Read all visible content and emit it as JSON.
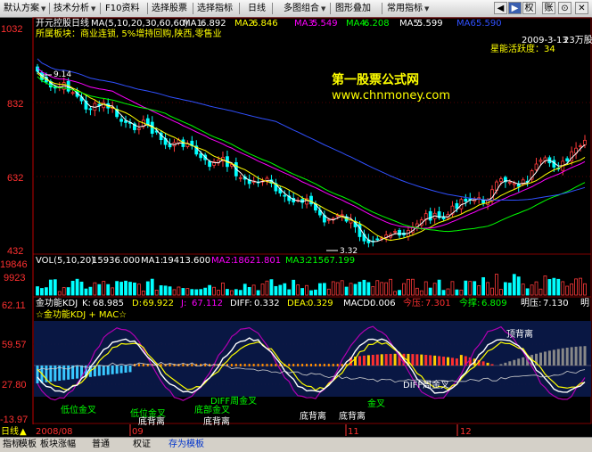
{
  "toolbar": {
    "items": [
      {
        "label": "默认方案",
        "dropdown": true
      },
      {
        "label": "技术分析",
        "dropdown": true
      },
      {
        "label": "F10资料",
        "dropdown": false
      },
      {
        "label": "选择股票",
        "dropdown": false
      },
      {
        "label": "选择指标",
        "dropdown": false
      },
      {
        "label": "日线",
        "dropdown": false
      },
      {
        "label": "多图组合",
        "dropdown": true
      },
      {
        "label": "图形叠加",
        "dropdown": false
      },
      {
        "label": "常用指标",
        "dropdown": true
      }
    ],
    "window_buttons": [
      "◀",
      "▶",
      "权",
      "账",
      "⊙",
      "✕"
    ]
  },
  "price_panel": {
    "name": "开元控股",
    "period": "日线",
    "ma_params": "MA(5,10,20,30,60,60)",
    "ma1_label": "MA1:",
    "ma1_value": "6.892",
    "ma2_label": "MA2:",
    "ma2_value": "6.846",
    "ma3_label": "MA3:",
    "ma3_value": "5.549",
    "ma4_label": "MA4:",
    "ma4_value": "6.208",
    "ma5_label": "MA5:",
    "ma5_value": "5.599",
    "ma6_label": "MA6:",
    "ma6_value": "5.590",
    "sector_line": "所属板块：商业连锁, 5%增持回购,陕西,零售业",
    "date_info": "2009-3-13",
    "share_info": "23万股",
    "star_info": "星能活跃度：34",
    "watermark_title": "第一股票公式网",
    "watermark_url": "www.chnmoney.com",
    "high_label": "9.14",
    "low_label": "3.32",
    "y_ticks": [
      "1032",
      "832",
      "632",
      "432"
    ]
  },
  "volume_panel": {
    "header_label": "VOL(5,10,20)",
    "vol_value": "15936.000",
    "ma1_label": "MA1:",
    "ma1_value": "19413.600",
    "ma2_label": "MA2:",
    "ma2_value": "18621.801",
    "ma3_label": "MA3:",
    "ma3_value": "21567.199",
    "y_ticks": [
      "19846",
      "9923"
    ]
  },
  "kdj_panel": {
    "title": "金功能KDJ",
    "k_label": "K:",
    "k_value": "68.985",
    "d_label": "D:",
    "d_value": "69.922",
    "j_label": "J:",
    "j_value": "67.112",
    "diff_label": "DIFF:",
    "diff_value": "0.332",
    "dea_label": "DEA:",
    "dea_value": "0.329",
    "macd_label": "MACD:",
    "macd_value": "0.006",
    "jinya_label": "今压:",
    "jinya_value": "7.301",
    "jinzhi_label": "今撑:",
    "jinzhi_value": "6.809",
    "mingya_label": "明压:",
    "mingya_value": "7.130",
    "ming_suffix": "明",
    "subtitle": "☆金功能KDJ + MAC☆",
    "y_ticks": [
      "62.11",
      "59.57",
      "27.80",
      "-13.97"
    ],
    "annotations": {
      "top_divergence": "顶背离",
      "diff_week_golden": "DIFF周金叉",
      "golden_cross_1": "低位金叉",
      "golden_cross_2": "低位金叉",
      "bottom_golden": "底部金叉",
      "bottom_div_1": "底背离",
      "bottom_div_2": "底背离",
      "bottom_div_3": "底背离",
      "bottom_div_4": "底背离",
      "week_golden": "DIFF周金叉",
      "cross_4": "金叉"
    }
  },
  "time_axis": {
    "period_label": "日线",
    "labels": [
      "2008/08",
      "09",
      "11",
      "12"
    ]
  },
  "bottom_tabs": [
    "指标",
    "模板",
    "板块涨幅",
    "普通",
    "权证",
    "存为模板"
  ],
  "colors": {
    "up": "#ff3a3a",
    "down": "#00ffff",
    "ma1": "#ffffff",
    "ma2": "#ffff00",
    "ma3": "#ff00ff",
    "ma4": "#00ff00",
    "ma5": "#3050ff",
    "grid": "#800000"
  }
}
